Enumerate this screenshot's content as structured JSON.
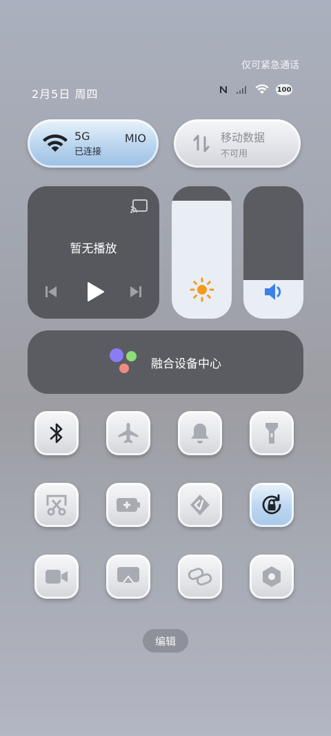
{
  "status_bar": {
    "emergency_text": "仅可紧急通话",
    "date": "2月5日 周四",
    "battery": "100"
  },
  "wifi_pill": {
    "network_type": "5G",
    "status": "已连接",
    "ssid": "MIO",
    "active": true
  },
  "mobile_pill": {
    "title": "移动数据",
    "status": "不可用",
    "active": false
  },
  "media": {
    "title": "暂无播放"
  },
  "sliders": {
    "brightness_level": 0.89,
    "volume_level": 0.29
  },
  "fusion": {
    "label": "融合设备中心"
  },
  "tiles": [
    {
      "name": "bluetooth",
      "icon": "bluetooth-icon",
      "active": true
    },
    {
      "name": "airplane",
      "icon": "airplane-icon",
      "active": false
    },
    {
      "name": "ring",
      "icon": "bell-icon",
      "active": false
    },
    {
      "name": "flashlight",
      "icon": "flashlight-icon",
      "active": false
    },
    {
      "name": "screenshot",
      "icon": "scissors-icon",
      "active": false
    },
    {
      "name": "battery-saver",
      "icon": "battery-plus-icon",
      "active": false
    },
    {
      "name": "share",
      "icon": "share-icon",
      "active": false
    },
    {
      "name": "rotation-lock",
      "icon": "rotation-lock-icon",
      "active": true
    },
    {
      "name": "screen-record",
      "icon": "video-camera-icon",
      "active": false
    },
    {
      "name": "cast-screen",
      "icon": "screen-cast-icon",
      "active": false
    },
    {
      "name": "link",
      "icon": "link-icon",
      "active": false
    },
    {
      "name": "settings",
      "icon": "hex-settings-icon",
      "active": false
    }
  ],
  "edit_button": {
    "label": "编辑"
  },
  "colors": {
    "active_blue": "#3a82ea",
    "sun_orange": "#f39a1c",
    "dot_purple": "#8b7cf4",
    "dot_green": "#8fdc7a",
    "dot_pink": "#f08a85"
  }
}
